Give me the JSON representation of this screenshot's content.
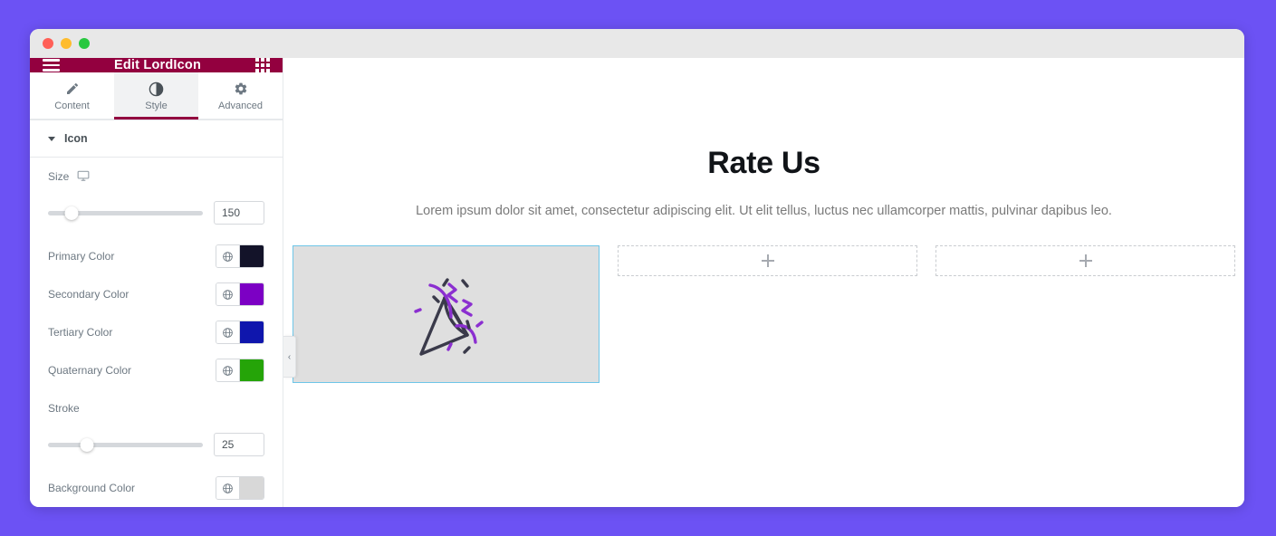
{
  "window": {
    "traffic_lights": [
      "close",
      "minimize",
      "maximize"
    ]
  },
  "panel": {
    "header": {
      "title": "Edit LordIcon",
      "menu_icon": "hamburger-icon",
      "apps_icon": "grid-apps-icon"
    },
    "tabs": [
      {
        "label": "Content",
        "icon": "pencil-icon",
        "active": false
      },
      {
        "label": "Style",
        "icon": "contrast-icon",
        "active": true
      },
      {
        "label": "Advanced",
        "icon": "gear-icon",
        "active": false
      }
    ],
    "section": {
      "title": "Icon",
      "expanded": true
    },
    "controls": {
      "size": {
        "label": "Size",
        "device_icon": "desktop-monitor-icon",
        "value": "150",
        "handle_percent": 15
      },
      "primary_color": {
        "label": "Primary Color",
        "globe_icon": "globe-icon",
        "swatch": "#131329"
      },
      "secondary_color": {
        "label": "Secondary Color",
        "globe_icon": "globe-icon",
        "swatch": "#7c00c4"
      },
      "tertiary_color": {
        "label": "Tertiary Color",
        "globe_icon": "globe-icon",
        "swatch": "#0f16ad"
      },
      "quaternary_color": {
        "label": "Quaternary Color",
        "globe_icon": "globe-icon",
        "swatch": "#25a408"
      },
      "stroke": {
        "label": "Stroke",
        "value": "25",
        "handle_percent": 25
      },
      "background_color": {
        "label": "Background Color",
        "globe_icon": "globe-icon",
        "swatch": "#d8d8d8"
      }
    }
  },
  "canvas": {
    "collapse_handle": "‹",
    "hero": {
      "title": "Rate Us",
      "subtitle": "Lorem ipsum dolor sit amet, consectetur adipiscing elit. Ut elit tellus, luctus nec ullamcorper mattis, pulvinar dapibus leo."
    },
    "widgets": {
      "selected_icon": "party-popper-confetti-icon",
      "placeholders": [
        "add-element",
        "add-element"
      ]
    }
  },
  "colors": {
    "page_background": "#6c52f4",
    "panel_header": "#93003f",
    "accent": "#93003f",
    "selection_border": "#6ec6e8",
    "widget_background": "#dfdfdf"
  }
}
